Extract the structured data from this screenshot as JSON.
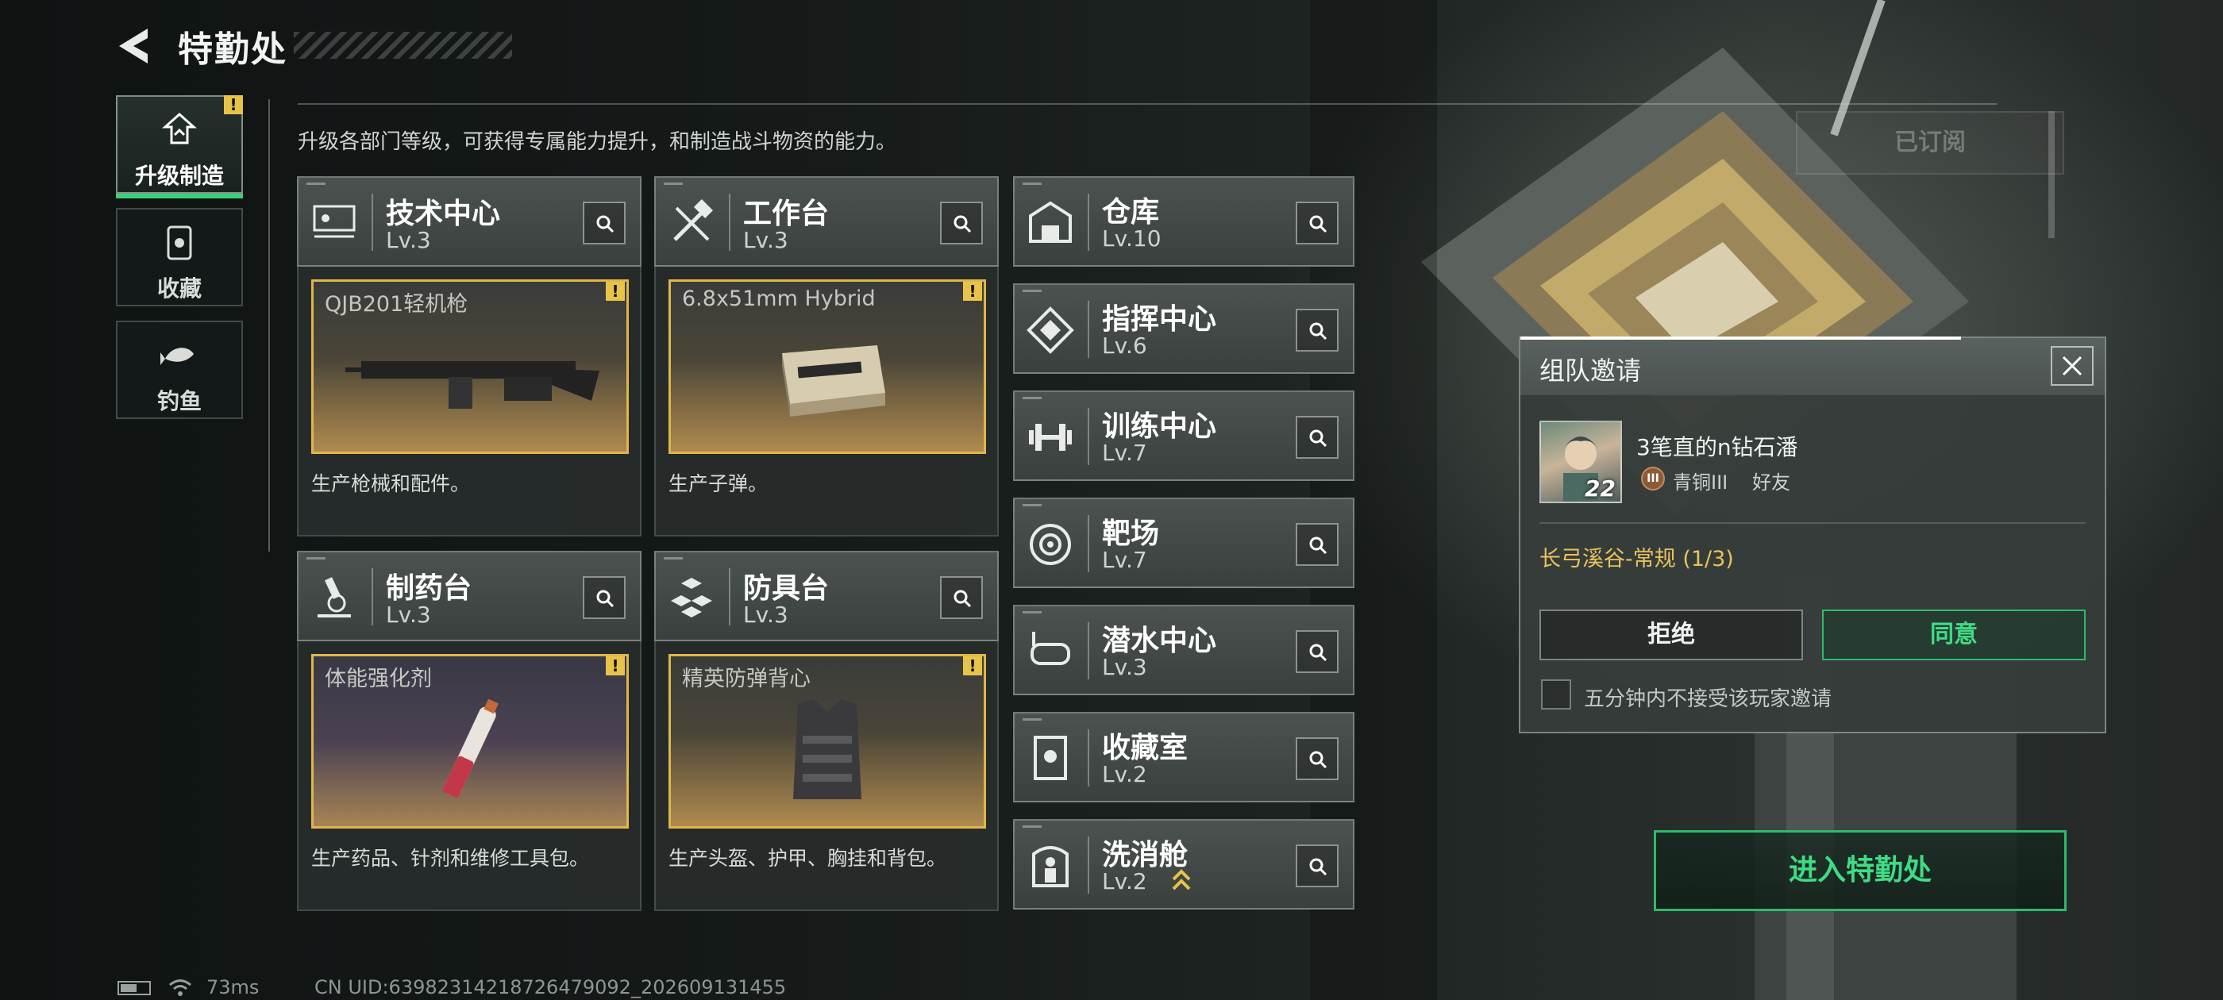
{
  "header": {
    "title": "特勤处"
  },
  "subtitle": "升级各部门等级，可获得专属能力提升，和制造战斗物资的能力。",
  "subscribed_label": "已订阅",
  "sidebar": {
    "items": [
      {
        "label": "升级制造",
        "icon": "upgrade-icon",
        "active": true,
        "badge": "!"
      },
      {
        "label": "收藏",
        "icon": "collection-icon"
      },
      {
        "label": "钓鱼",
        "icon": "fish-icon"
      }
    ]
  },
  "departments": [
    {
      "name": "技术中心",
      "level": "Lv.3",
      "item": "QJB201轻机枪",
      "desc": "生产枪械和配件。",
      "badge": "!"
    },
    {
      "name": "工作台",
      "level": "Lv.3",
      "item": "6.8x51mm Hybrid",
      "desc": "生产子弹。",
      "badge": "!"
    },
    {
      "name": "制药台",
      "level": "Lv.3",
      "item": "体能强化剂",
      "desc": "生产药品、针剂和维修工具包。",
      "badge": "!"
    },
    {
      "name": "防具台",
      "level": "Lv.3",
      "item": "精英防弹背心",
      "desc": "生产头盔、护甲、胸挂和背包。",
      "badge": "!"
    }
  ],
  "facilities": [
    {
      "name": "仓库",
      "level": "Lv.10",
      "icon": "warehouse-icon"
    },
    {
      "name": "指挥中心",
      "level": "Lv.6",
      "icon": "command-icon"
    },
    {
      "name": "训练中心",
      "level": "Lv.7",
      "icon": "dumbbell-icon"
    },
    {
      "name": "靶场",
      "level": "Lv.7",
      "icon": "target-icon"
    },
    {
      "name": "潜水中心",
      "level": "Lv.3",
      "icon": "dive-mask-icon"
    },
    {
      "name": "收藏室",
      "level": "Lv.2",
      "icon": "collection-room-icon"
    },
    {
      "name": "洗消舱",
      "level": "Lv.2",
      "icon": "decon-icon",
      "upgradable": true
    }
  ],
  "invite": {
    "title": "组队邀请",
    "player_name": "3笔直的n钻石潘",
    "player_level": "22",
    "rank_badge": "III",
    "rank": "青铜III",
    "relation": "好友",
    "mode": "长弓溪谷-常规 (1/3)",
    "reject_label": "拒绝",
    "accept_label": "同意",
    "mute_label": "五分钟内不接受该玩家邀请"
  },
  "enter_label": "进入特勤处",
  "status": {
    "ping": "73ms",
    "uid": "CN UID:6398231421872647909​2_202609131455"
  },
  "colors": {
    "accent_green": "#3ad079",
    "warning_yellow": "#e7c34a",
    "mode_gold": "#e8c45a"
  }
}
